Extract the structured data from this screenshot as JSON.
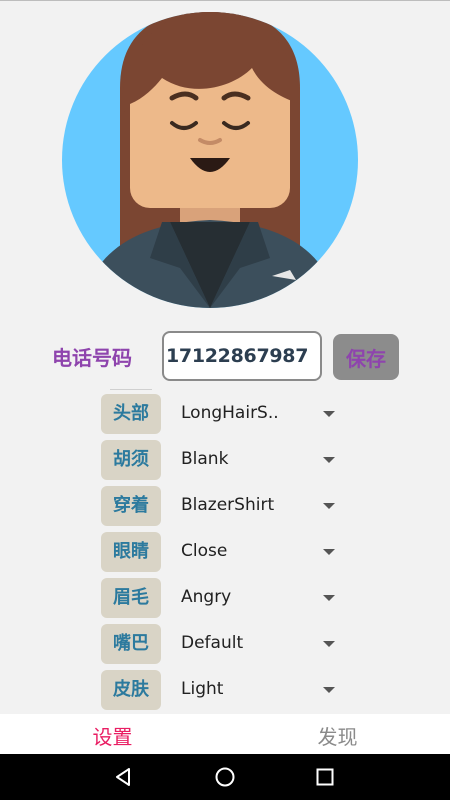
{
  "profile": {
    "phone_label": "电话号码",
    "phone_value": "17122867987",
    "save_label": "保存"
  },
  "options": [
    {
      "label": "头部",
      "value": "LongHairS.."
    },
    {
      "label": "胡须",
      "value": "Blank"
    },
    {
      "label": "穿着",
      "value": "BlazerShirt"
    },
    {
      "label": "眼睛",
      "value": "Close"
    },
    {
      "label": "眉毛",
      "value": "Angry"
    },
    {
      "label": "嘴巴",
      "value": "Default"
    },
    {
      "label": "皮肤",
      "value": "Light"
    }
  ],
  "tabs": [
    {
      "label": "设置",
      "active": true
    },
    {
      "label": "发现",
      "active": false
    }
  ],
  "colors": {
    "accent": "#e91e63",
    "label_purple": "#8e44ad",
    "option_label": "#2c7a9e",
    "avatar_bg": "#65c9ff",
    "hair": "#7b4632",
    "skin": "#edb98a",
    "blazer": "#3c4f5c"
  },
  "system_nav": {
    "back_icon": "triangle-back-icon",
    "home_icon": "circle-home-icon",
    "recents_icon": "square-recents-icon"
  }
}
